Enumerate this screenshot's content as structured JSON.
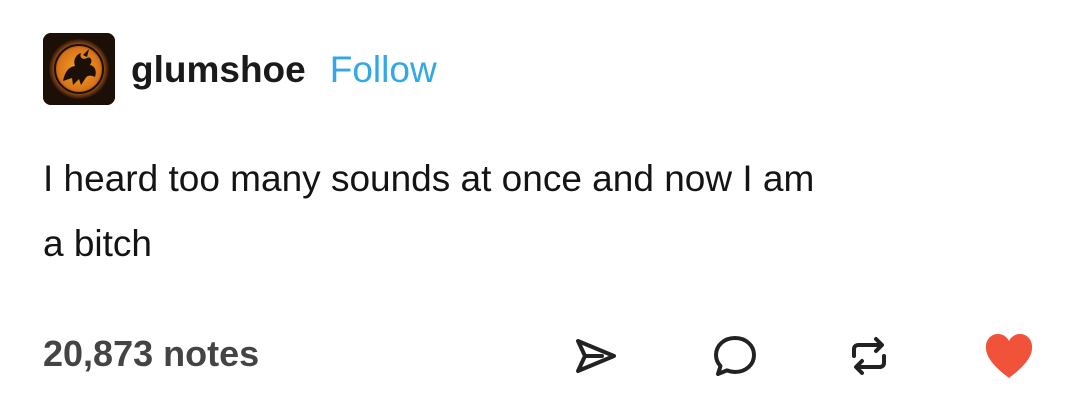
{
  "post": {
    "username": "glumshoe",
    "follow_label": "Follow",
    "avatar_icon": "griffin-icon",
    "body_lines": [
      "I heard too many sounds at once and now I am",
      "a bitch"
    ],
    "notes": "20,873 notes",
    "actions": {
      "share_icon": "share-icon",
      "reply_icon": "reply-icon",
      "reblog_icon": "reblog-icon",
      "like_icon": "heart-icon"
    }
  },
  "colors": {
    "follow": "#32a8e6",
    "like": "#f0533a",
    "text": "#141414",
    "notes": "#444444"
  }
}
